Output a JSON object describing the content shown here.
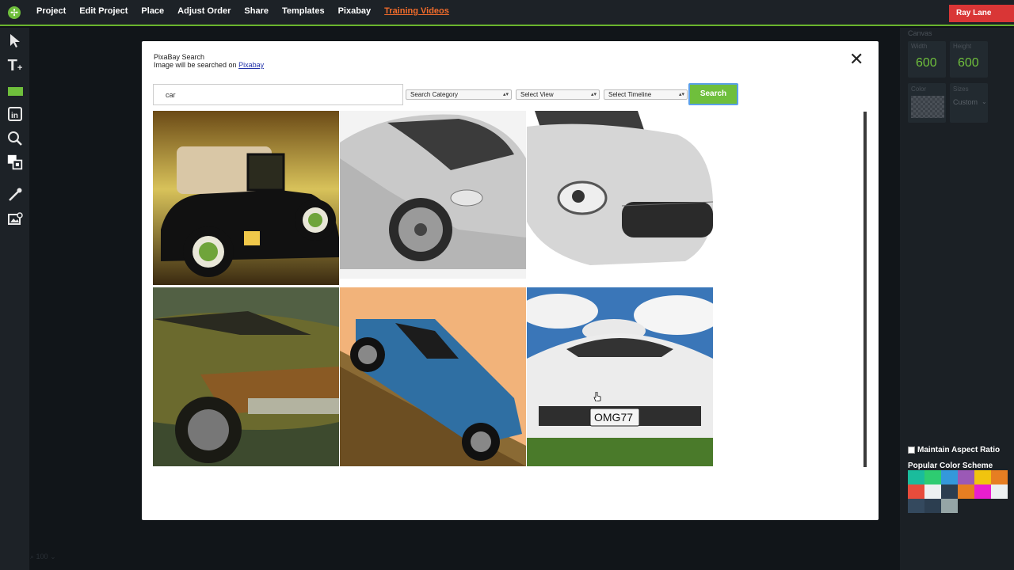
{
  "menu": [
    "Project",
    "Edit Project",
    "Place",
    "Adjust Order",
    "Share",
    "Templates",
    "Pixabay",
    "Training Videos"
  ],
  "active_menu": "Training Videos",
  "user": {
    "name": "Ray Lane"
  },
  "right_panel": {
    "canvas_label": "Canvas",
    "width_label": "Width",
    "height_label": "Height",
    "width": "600",
    "height": "600",
    "color_label": "Color",
    "sizes_label": "Sizes",
    "size_value": "Custom",
    "maintain_aspect": "Maintain Aspect Ratio",
    "popular_label": "Popular Color Scheme",
    "swatches": [
      "#1abc9c",
      "#2ecc71",
      "#3498db",
      "#9b59b6",
      "#f1c40f",
      "#e67e22",
      "#e74c3c",
      "#ecf0f1",
      "#2c3e50",
      "#e67e22",
      "#e91ecf",
      "#ecf0f1",
      "#34495e",
      "#2c3e50",
      "#95a5a6"
    ]
  },
  "zoom": "100",
  "modal": {
    "title": "PixaBay Search",
    "subtitle_prefix": "Image will be searched on ",
    "subtitle_link": "Pixabay",
    "search_value": "car",
    "category_select": "Search Category",
    "view_select": "Select View",
    "timeline_select": "Select Timeline",
    "search_button": "Search"
  },
  "results": [
    {
      "name": "vintage-black-car"
    },
    {
      "name": "silver-sports-car"
    },
    {
      "name": "white-sports-car-front"
    },
    {
      "name": "rusty-green-car"
    },
    {
      "name": "blue-car-on-hill"
    },
    {
      "name": "white-corvette-omg77"
    }
  ],
  "plate_text": "OMG77",
  "colors": {
    "accent": "#6fbf3c",
    "user_button": "#d93636",
    "active_menu": "#f26c2b"
  }
}
